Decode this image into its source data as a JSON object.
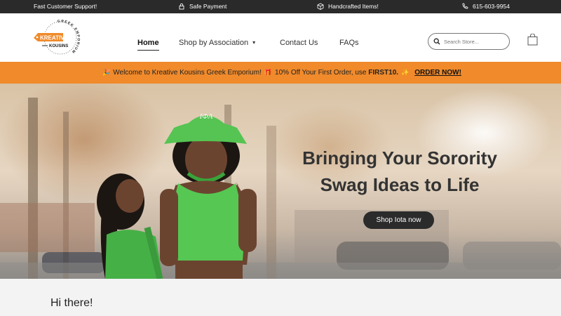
{
  "topbar": {
    "support": "Fast Customer Support!",
    "payment": "Safe Payment",
    "handcrafted": "Handcrafted Items!",
    "phone": "615-603-9954"
  },
  "logo": {
    "arc_text": "GREEK EMPORIUM",
    "word1": "KREATIVE",
    "word2": "KOUSINS",
    "brand_color": "#f08a2b"
  },
  "nav": {
    "home": "Home",
    "association": "Shop by Association",
    "contact": "Contact Us",
    "faqs": "FAQs"
  },
  "search": {
    "placeholder": "Search Store..."
  },
  "promo": {
    "welcome": "Welcome to Kreative Kousins Greek Emporium!",
    "offer": "10% Off Your First Order, use",
    "code": "FIRST10.",
    "cta": "ORDER NOW!",
    "bg_color": "#f08a2b"
  },
  "hero": {
    "line1": "Bringing Your Sorority",
    "line2": "Swag Ideas to Life",
    "button": "Shop Iota now",
    "hat_text": "IΦA"
  },
  "intro": {
    "greeting": "Hi there!"
  }
}
